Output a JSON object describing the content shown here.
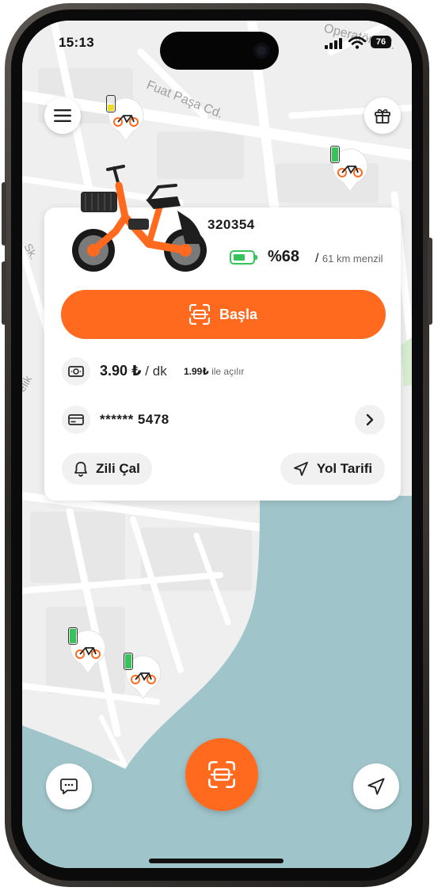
{
  "status_bar": {
    "time": "15:13",
    "battery": "76"
  },
  "map": {
    "street_labels": [
      "Fuat Paşa Cd.",
      "Operatör Cd.",
      "Sk.",
      "elik"
    ]
  },
  "markers": [
    {
      "battery": "low",
      "color": "#e9dc2a"
    },
    {
      "battery": "full",
      "color": "#35c35a"
    },
    {
      "battery": "full",
      "color": "#35c35a"
    },
    {
      "battery": "full",
      "color": "#35c35a"
    }
  ],
  "vehicle": {
    "id": "320354",
    "charge": "%68",
    "range": "61 km menzil",
    "start_label": "Başla",
    "price": "3.90 ₺",
    "price_unit": "dk",
    "opening_fee": "1.99₺",
    "opening_text": "ile açılır",
    "card_number": "****** 5478",
    "ring_label": "Zili Çal",
    "directions_label": "Yol Tarifi"
  },
  "icons": [
    "menu-icon",
    "gift-icon",
    "chat-icon",
    "scan-icon",
    "navigate-icon",
    "bell-icon",
    "money-icon",
    "credit-card-icon",
    "chevron-right-icon"
  ],
  "colors": {
    "accent": "#ff6a1f",
    "battery_green": "#35c35a",
    "battery_yellow": "#e9dc2a",
    "water": "#9fc5ca"
  }
}
